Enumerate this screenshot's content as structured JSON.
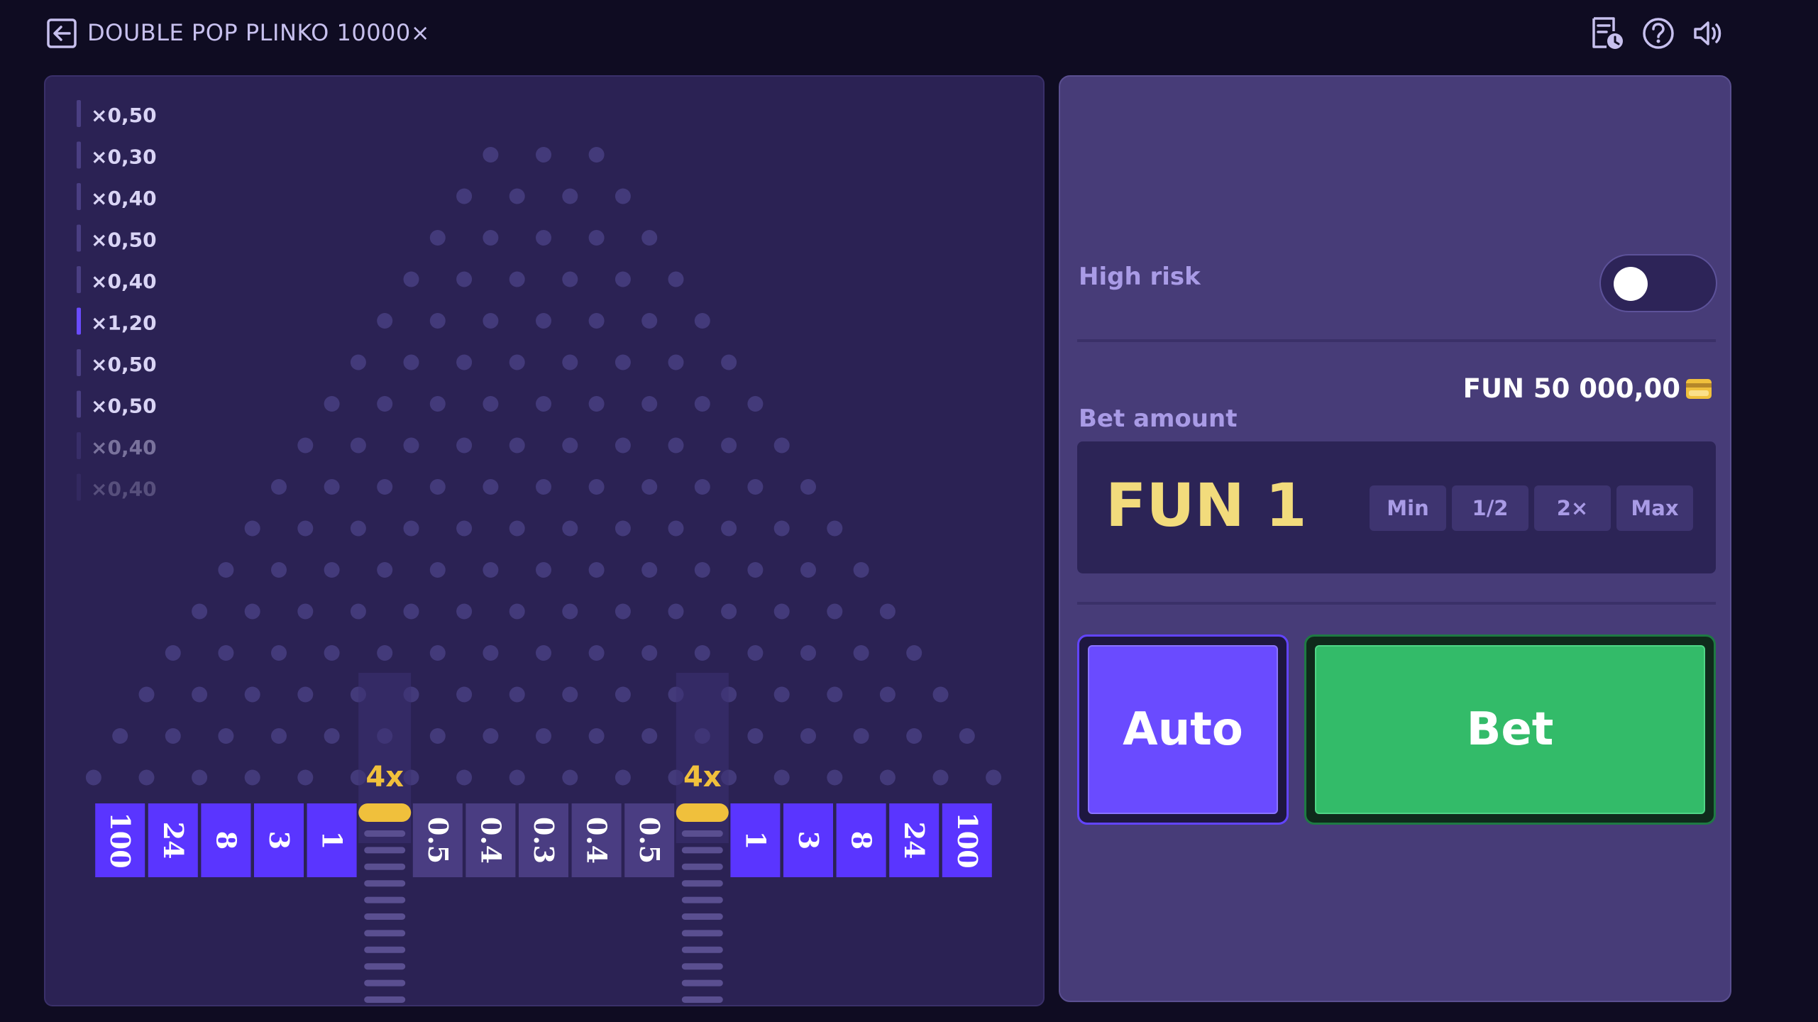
{
  "header": {
    "title": "DOUBLE POP PLINKO 10000×",
    "exit_icon": "exit-icon",
    "history_icon": "history-icon",
    "help_icon": "help-icon",
    "sound_icon": "sound-icon"
  },
  "history": {
    "items": [
      "×0,50",
      "×0,30",
      "×0,40",
      "×0,50",
      "×0,40",
      "×1,20",
      "×0,50",
      "×0,50",
      "×0,40",
      "×0,40"
    ],
    "highlight_index": 5
  },
  "board": {
    "rows": 16,
    "multipliers": [
      "100",
      "24",
      "8",
      "3",
      "1",
      "",
      "0.5",
      "0.4",
      "0.3",
      "0.4",
      "0.5",
      "",
      "1",
      "3",
      "8",
      "24",
      "100"
    ],
    "special_slots": [
      5,
      11
    ],
    "special_label": "4x"
  },
  "controls": {
    "risk_label": "High risk",
    "risk_enabled": false,
    "balance": "FUN 50 000,00",
    "bet_label": "Bet amount",
    "bet_value": "FUN 1",
    "chips": [
      "Min",
      "1/2",
      "2×",
      "Max"
    ],
    "auto_label": "Auto",
    "bet_button_label": "Bet"
  },
  "colors": {
    "background": "#0f0c22",
    "board": "#2b2254",
    "panel": "#473c78",
    "slot": "#5a35ff",
    "slot_low": "#4a3d82",
    "gold": "#f0c03c",
    "bet_green": "#33bb69",
    "auto_purple": "#6a4bff"
  }
}
